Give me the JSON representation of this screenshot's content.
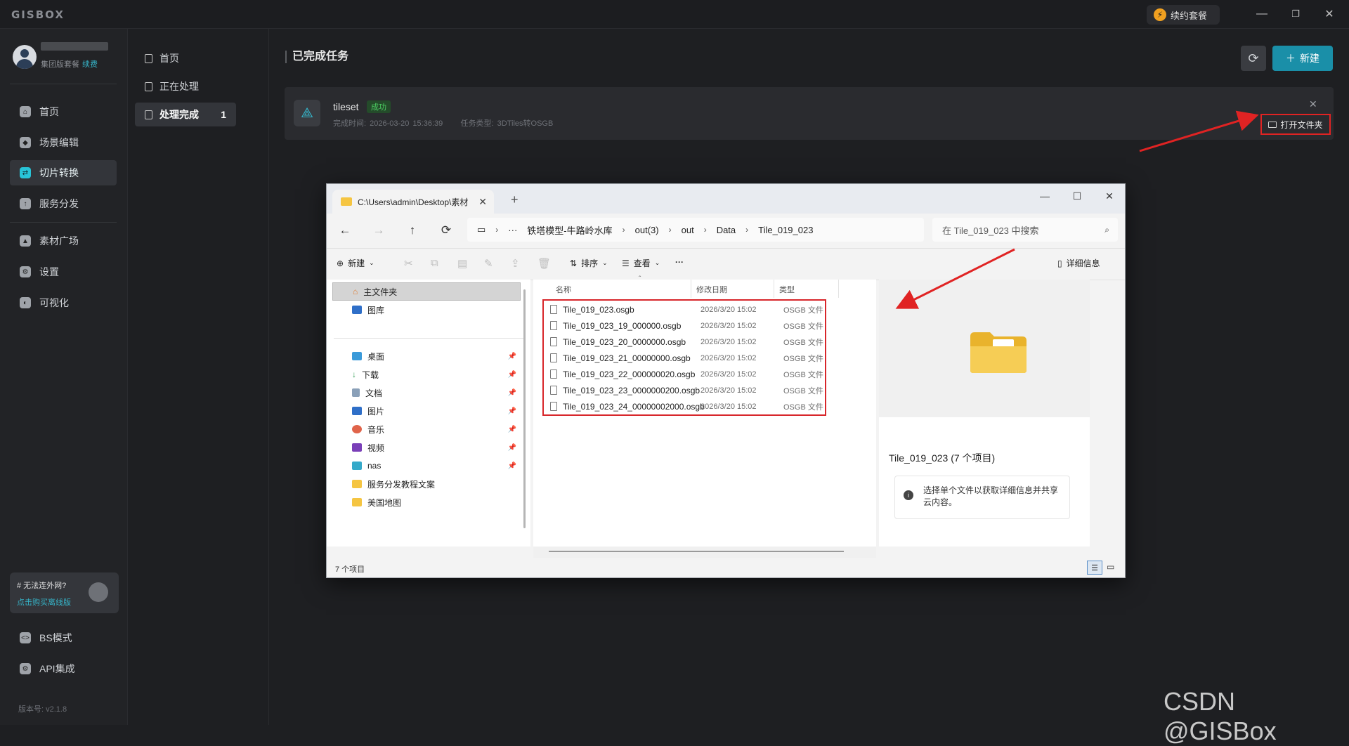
{
  "app": {
    "logo": "GISBOX",
    "renew_label": "续约套餐",
    "window_controls": [
      "minimize-icon",
      "restore-icon",
      "close-icon"
    ]
  },
  "account": {
    "plan": "集团版套餐",
    "renew_link": "续费"
  },
  "sidebar": {
    "items": [
      {
        "label": "首页",
        "icon": "home-icon"
      },
      {
        "label": "场景编辑",
        "icon": "cube-icon"
      },
      {
        "label": "切片转换",
        "icon": "convert-icon",
        "active": true
      },
      {
        "label": "服务分发",
        "icon": "upload-icon"
      },
      {
        "label": "素材广场",
        "icon": "image-icon"
      },
      {
        "label": "设置",
        "icon": "gear-icon"
      },
      {
        "label": "可视化",
        "icon": "chart-icon"
      }
    ],
    "offline_title": "# 无法连外网?",
    "offline_link": "点击购买离线版",
    "bottom_items": [
      {
        "label": "BS模式",
        "icon": "code-icon"
      },
      {
        "label": "API集成",
        "icon": "api-icon"
      }
    ],
    "version": "版本号:  v2.1.8"
  },
  "subnav": {
    "items": [
      {
        "label": "首页"
      },
      {
        "label": "正在处理"
      },
      {
        "label": "处理完成",
        "count": "1",
        "active": true
      }
    ]
  },
  "main": {
    "title": "已完成任务",
    "new_button": "新建",
    "task": {
      "name": "tileset",
      "status": "成功",
      "completed": "完成时间: 2026-03-20 15:36:39",
      "type": "任务类型: 3DTiles转OSGB",
      "open_folder": "打开文件夹"
    }
  },
  "explorer": {
    "tab_title": "C:\\Users\\admin\\Desktop\\素材",
    "breadcrumb": [
      "铁塔模型-牛路岭水库",
      "out(3)",
      "out",
      "Data",
      "Tile_019_023"
    ],
    "search_placeholder": "在 Tile_019_023 中搜索",
    "toolbar": {
      "new": "新建",
      "sort": "排序",
      "view": "查看",
      "more": "···",
      "details": "详细信息"
    },
    "tree": [
      {
        "label": "主文件夹",
        "icon": "home-icon",
        "selected": true
      },
      {
        "label": "图库",
        "icon": "gallery-icon"
      },
      {
        "label": "桌面",
        "icon": "desktop-icon",
        "pinned": true
      },
      {
        "label": "下载",
        "icon": "download-icon",
        "pinned": true
      },
      {
        "label": "文档",
        "icon": "document-icon",
        "pinned": true
      },
      {
        "label": "图片",
        "icon": "picture-icon",
        "pinned": true
      },
      {
        "label": "音乐",
        "icon": "music-icon",
        "pinned": true
      },
      {
        "label": "视频",
        "icon": "video-icon",
        "pinned": true
      },
      {
        "label": "nas",
        "icon": "monitor-icon",
        "pinned": true
      },
      {
        "label": "服务分发教程文案",
        "icon": "folder-icon"
      },
      {
        "label": "美国地图",
        "icon": "folder-icon"
      }
    ],
    "columns": [
      "名称",
      "修改日期",
      "类型"
    ],
    "files": [
      {
        "name": "Tile_019_023.osgb",
        "date": "2026/3/20 15:02",
        "type": "OSGB 文件"
      },
      {
        "name": "Tile_019_023_19_000000.osgb",
        "date": "2026/3/20 15:02",
        "type": "OSGB 文件"
      },
      {
        "name": "Tile_019_023_20_0000000.osgb",
        "date": "2026/3/20 15:02",
        "type": "OSGB 文件"
      },
      {
        "name": "Tile_019_023_21_00000000.osgb",
        "date": "2026/3/20 15:02",
        "type": "OSGB 文件"
      },
      {
        "name": "Tile_019_023_22_000000020.osgb",
        "date": "2026/3/20 15:02",
        "type": "OSGB 文件"
      },
      {
        "name": "Tile_019_023_23_0000000200.osgb",
        "date": "2026/3/20 15:02",
        "type": "OSGB 文件"
      },
      {
        "name": "Tile_019_023_24_00000002000.osgb",
        "date": "2026/3/20 15:02",
        "type": "OSGB 文件"
      }
    ],
    "detail_title": "Tile_019_023 (7 个项目)",
    "detail_info": "选择单个文件以获取详细信息并共享云内容。",
    "status_count": "7 个项目"
  },
  "watermark": "CSDN @GISBox",
  "colors": {
    "accent": "#1a8fa8",
    "active_icon": "#28c4d8",
    "highlight": "#e02323"
  }
}
